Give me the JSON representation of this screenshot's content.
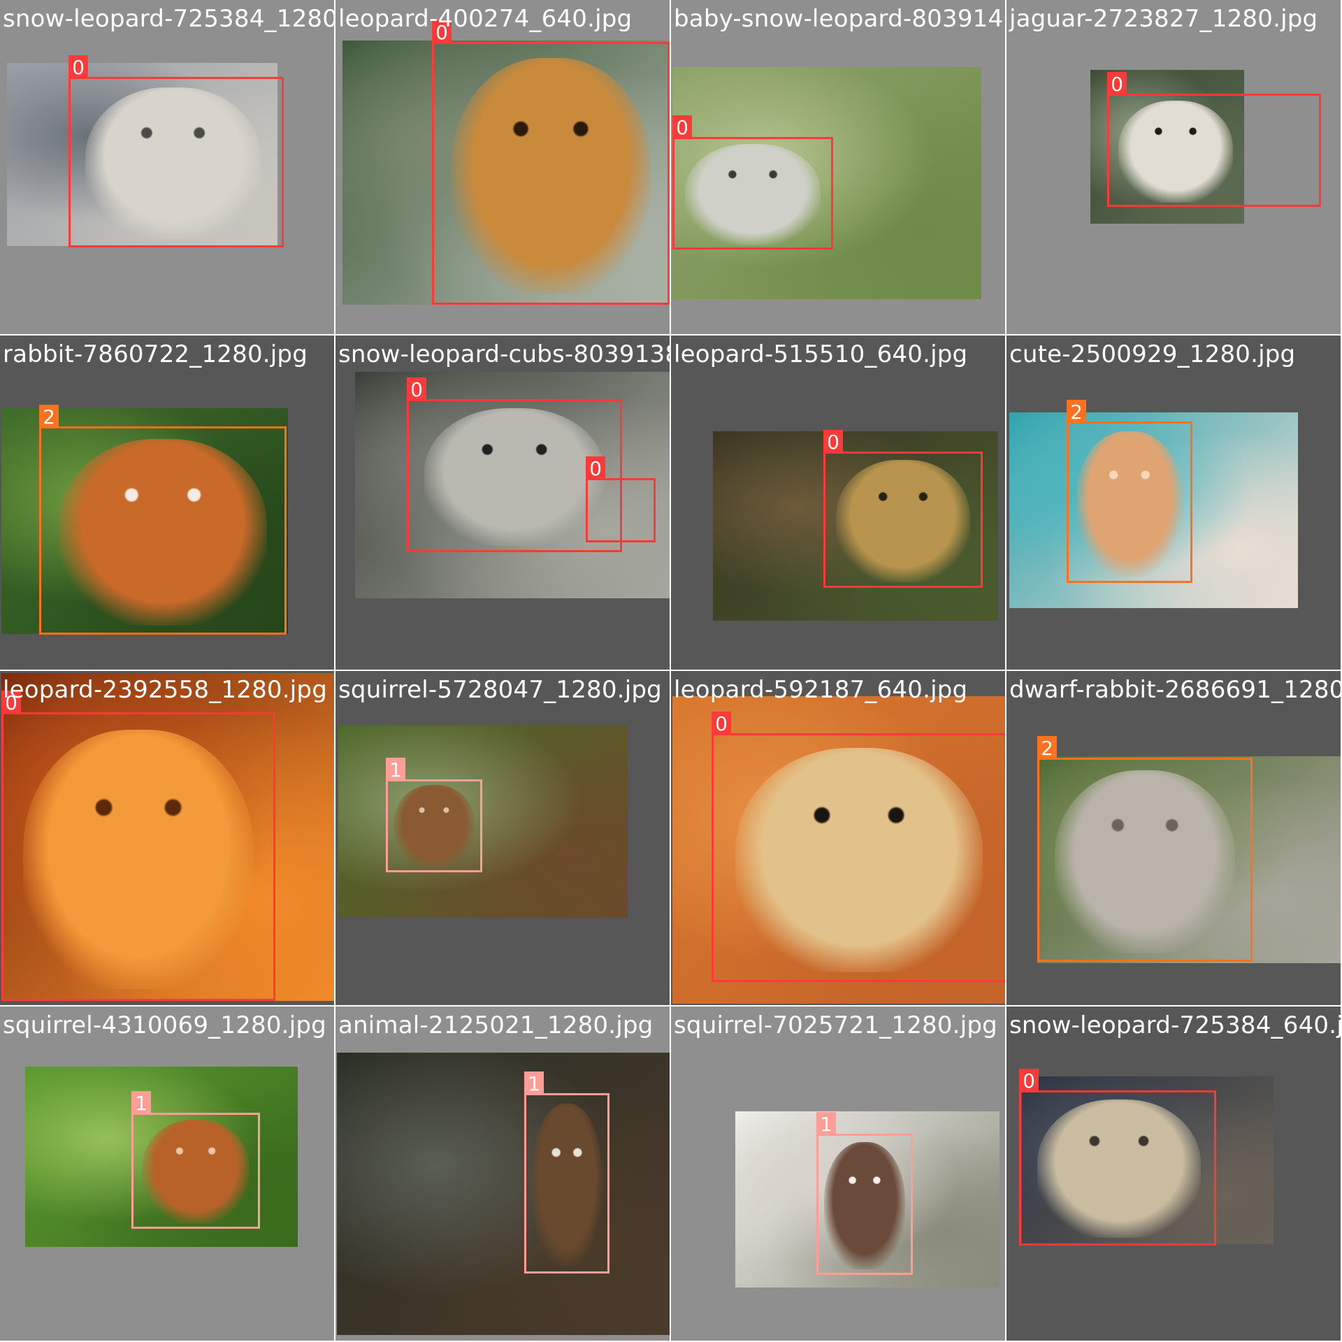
{
  "mosaic": {
    "colors": {
      "class_0": "#ff3838",
      "class_1": "#ff9d97",
      "class_2": "#ff701f",
      "tile_bg_light": "#8f8f8f",
      "tile_bg_dark": "#575757"
    },
    "tiles": [
      {
        "filename": "snow-leopard-725384_1280.jpg",
        "background": "#8f8f8f",
        "photo": {
          "fill": [
            "#9a9fa6",
            "#6b727a",
            "#c9c6bf"
          ],
          "subject": "snow-leopard",
          "subject_color": [
            "#d8d4cc",
            "#4c4a46"
          ]
        },
        "detections": [
          {
            "class_id": "0",
            "color": "#ff3838"
          }
        ]
      },
      {
        "filename": "leopard-400274_640.jpg",
        "background": "#8f8f8f",
        "photo": {
          "fill": [
            "#3f5a3a",
            "#7d8a74",
            "#aab2a6"
          ],
          "subject": "leopard",
          "subject_color": [
            "#c98a3c",
            "#2a1a0c"
          ]
        },
        "detections": [
          {
            "class_id": "0",
            "color": "#ff3838"
          }
        ]
      },
      {
        "filename": "baby-snow-leopard-8039146_1280.jpg",
        "background": "#8f8f8f",
        "photo": {
          "fill": [
            "#8ea36a",
            "#b5c48f",
            "#6f8a48"
          ],
          "subject": "snow-leopard-cub",
          "subject_color": [
            "#cfd0c8",
            "#3b3c36"
          ]
        },
        "detections": [
          {
            "class_id": "0",
            "color": "#ff3838"
          }
        ]
      },
      {
        "filename": "jaguar-2723827_1280.jpg",
        "background": "#8f8f8f",
        "photo": {
          "fill": [
            "#3d4a33",
            "#8d9b83",
            "#5d6a52"
          ],
          "subject": "jaguar",
          "subject_color": [
            "#e2ddd2",
            "#1d1c1a"
          ]
        },
        "detections": [
          {
            "class_id": "0",
            "color": "#ff3838"
          }
        ]
      },
      {
        "filename": "rabbit-7860722_1280.jpg",
        "background": "#575757",
        "photo": {
          "fill": [
            "#3d6b2a",
            "#6f9a3e",
            "#25461a"
          ],
          "subject": "rabbit",
          "subject_color": [
            "#c9692a",
            "#f3ece4"
          ]
        },
        "detections": [
          {
            "class_id": "2",
            "color": "#ff701f"
          }
        ]
      },
      {
        "filename": "snow-leopard-cubs-8039138_1280.jpg",
        "background": "#575757",
        "photo": {
          "fill": [
            "#3a3f38",
            "#7b7e76",
            "#a6a79f"
          ],
          "subject": "snow-leopard-cubs",
          "subject_color": [
            "#b9b9b2",
            "#202020"
          ]
        },
        "detections": [
          {
            "class_id": "0",
            "color": "#ff3838"
          },
          {
            "class_id": "0",
            "color": "#ff3838"
          }
        ]
      },
      {
        "filename": "leopard-515510_640.jpg",
        "background": "#575757",
        "photo": {
          "fill": [
            "#3a3422",
            "#6d5a3a",
            "#4a5a2e"
          ],
          "subject": "leopard",
          "subject_color": [
            "#b8944e",
            "#2a2112"
          ]
        },
        "detections": [
          {
            "class_id": "0",
            "color": "#ff3838"
          }
        ]
      },
      {
        "filename": "cute-2500929_1280.jpg",
        "background": "#575757",
        "photo": {
          "fill": [
            "#2fa3ae",
            "#4cb6bf",
            "#e8ddd3"
          ],
          "subject": "rabbit",
          "subject_color": [
            "#e0a472",
            "#f3d9c0"
          ]
        },
        "detections": [
          {
            "class_id": "2",
            "color": "#ff701f"
          }
        ]
      },
      {
        "filename": "leopard-2392558_1280.jpg",
        "background": "#575757",
        "photo": {
          "fill": [
            "#7a2a0e",
            "#c9561a",
            "#f08a2a"
          ],
          "subject": "leopard",
          "subject_color": [
            "#f39a3a",
            "#5a2a0a"
          ]
        },
        "detections": [
          {
            "class_id": "0",
            "color": "#ff3838"
          }
        ]
      },
      {
        "filename": "squirrel-5728047_1280.jpg",
        "background": "#575757",
        "photo": {
          "fill": [
            "#4e6a2a",
            "#8a9a6a",
            "#6a4a2a"
          ],
          "subject": "squirrel",
          "subject_color": [
            "#8a5a32",
            "#d7c2a8"
          ]
        },
        "detections": [
          {
            "class_id": "1",
            "color": "#ff9d97"
          }
        ]
      },
      {
        "filename": "leopard-592187_640.jpg",
        "background": "#575757",
        "photo": {
          "fill": [
            "#d9782e",
            "#e79044",
            "#c4632a"
          ],
          "subject": "leopard",
          "subject_color": [
            "#e2c28a",
            "#1a1510"
          ]
        },
        "detections": [
          {
            "class_id": "0",
            "color": "#ff3838"
          }
        ]
      },
      {
        "filename": "dwarf-rabbit-2686691_1280.jpg",
        "background": "#575757",
        "photo": {
          "fill": [
            "#4f6a32",
            "#7d8f5a",
            "#a8a59a"
          ],
          "subject": "rabbit",
          "subject_color": [
            "#b9b3a9",
            "#6a645a"
          ]
        },
        "detections": [
          {
            "class_id": "2",
            "color": "#ff701f"
          }
        ]
      },
      {
        "filename": "squirrel-4310069_1280.jpg",
        "background": "#8f8f8f",
        "photo": {
          "fill": [
            "#5c9a2e",
            "#96c15a",
            "#3a6a1e"
          ],
          "subject": "squirrel",
          "subject_color": [
            "#b8622a",
            "#e9c7a0"
          ]
        },
        "detections": [
          {
            "class_id": "1",
            "color": "#ff9d97"
          }
        ]
      },
      {
        "filename": "animal-2125021_1280.jpg",
        "background": "#8f8f8f",
        "photo": {
          "fill": [
            "#2a2e25",
            "#5a5e55",
            "#4a3a2a"
          ],
          "subject": "squirrel",
          "subject_color": [
            "#6a4a2e",
            "#e8e2d6"
          ]
        },
        "detections": [
          {
            "class_id": "1",
            "color": "#ff9d97"
          }
        ]
      },
      {
        "filename": "squirrel-7025721_1280.jpg",
        "background": "#8f8f8f",
        "photo": {
          "fill": [
            "#f2f0ec",
            "#d8d4cc",
            "#8a8a7a"
          ],
          "subject": "squirrel",
          "subject_color": [
            "#6a4a3a",
            "#f3efe8"
          ]
        },
        "detections": [
          {
            "class_id": "1",
            "color": "#ff9d97"
          }
        ]
      },
      {
        "filename": "snow-leopard-725384_640.jpg",
        "background": "#575757",
        "photo": {
          "fill": [
            "#2a3240",
            "#4a5260",
            "#6a6258"
          ],
          "subject": "snow-leopard",
          "subject_color": [
            "#c9bca0",
            "#3a3630"
          ]
        },
        "detections": [
          {
            "class_id": "0",
            "color": "#ff3838"
          }
        ]
      }
    ]
  }
}
